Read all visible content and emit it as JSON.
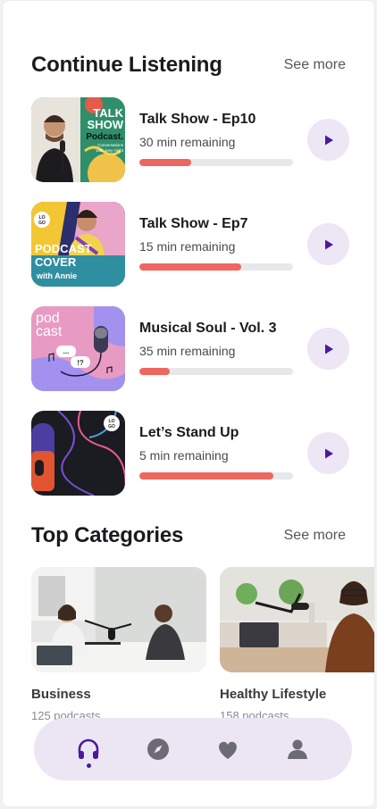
{
  "continue_listening": {
    "title": "Continue Listening",
    "see_more": "See more",
    "items": [
      {
        "title": "Talk Show - Ep10",
        "remaining": "30 min remaining",
        "progress": 0.34,
        "cover_text": [
          "TALK",
          "SHOW",
          "Podcast.",
          "Conversations",
          "with Joey Hight"
        ]
      },
      {
        "title": "Talk Show - Ep7",
        "remaining": "15 min remaining",
        "progress": 0.66,
        "cover_text": [
          "LO",
          "GO",
          "PODCAST",
          "COVER",
          "with Annie"
        ]
      },
      {
        "title": "Musical Soul - Vol. 3",
        "remaining": "35 min remaining",
        "progress": 0.2,
        "cover_text": [
          "pod",
          "cast",
          "...",
          "!?"
        ]
      },
      {
        "title": "Let’s Stand Up",
        "remaining": "5 min remaining",
        "progress": 0.87,
        "cover_text": [
          "LO",
          "GO"
        ]
      }
    ]
  },
  "top_categories": {
    "title": "Top Categories",
    "see_more": "See more",
    "items": [
      {
        "name": "Business",
        "count": "125 podcasts"
      },
      {
        "name": "Healthy Lifestyle",
        "count": "158 podcasts"
      }
    ]
  },
  "bottom_nav": {
    "active": "headphones-icon",
    "items": [
      "headphones-icon",
      "compass-icon",
      "heart-icon",
      "profile-icon"
    ]
  },
  "colors": {
    "accent": "#4b1a9c",
    "progress": "#ee6660",
    "play_bg": "#ece6f5",
    "nav_bg": "#ece6f4"
  }
}
